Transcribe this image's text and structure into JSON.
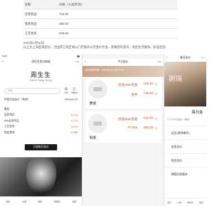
{
  "table": {
    "header": {
      "name": "名称",
      "price": "价格（人民币/克）"
    },
    "rows": [
      {
        "name": "足金饰品",
        "price": "723.00"
      },
      {
        "name": "铂金饰品",
        "price": "360.00"
      },
      {
        "name": "工艺金条",
        "price": "678.00"
      }
    ],
    "date": "2024年4月10日",
    "note": "以上为上海区域金价，全国其它地区请以门店报价公示金价为准，感谢您的支持，祝您生活愉快，好运连连!"
  },
  "panel1": {
    "status_time": "9:41",
    "nav_title": "周生生官方商城",
    "brand_logo": "周生生",
    "brand_sub": "Chow Sang Sang",
    "search_placeholder": "搜索",
    "icon_labels": [
      "分类",
      "购物车"
    ],
    "info_left": "中国大陆金价（每克）",
    "info_right": "2024-04-10",
    "section_label": "黄金:",
    "items": [
      {
        "label": "足金饰品",
        "value": "¥ 723"
      },
      {
        "label": "999足金饰品",
        "value": "¥ 723"
      },
      {
        "label": "工艺金条",
        "value": "¥ 678"
      },
      {
        "label": "铂金首饰",
        "value": "¥ 360"
      }
    ],
    "button_label": "订阅每日金价",
    "tabs": [
      "首页",
      "分类",
      "服务",
      "购物车",
      "我的"
    ]
  },
  "panel2": {
    "nav_title": "今日金价",
    "banner_text": "金价更新时间：2024年4月10日 09:21",
    "gold": {
      "name": "黄金",
      "lines": [
        {
          "label": "足金999/足金",
          "price": "728.00",
          "unit": "元"
        },
        {
          "label": "金条",
          "price": "718.00",
          "unit": "元"
        }
      ]
    },
    "platinum": {
      "name": "铂金",
      "lines": [
        {
          "label": "足铂999/足铂",
          "price": "416.00",
          "unit": "元"
        },
        {
          "label": "PT950",
          "price": "399.00",
          "unit": "元"
        }
      ]
    }
  },
  "panel3": {
    "nav_title": "每日金价",
    "photo_logo": "謝瑞",
    "sheet_title": "每日金",
    "sheet_note": "以下为今日金价（每克）",
    "options": [
      "足金(首饰操作)",
      "金条金价",
      "铂金金价",
      "增值回收服务"
    ],
    "tabs": [
      "首页",
      "分类",
      "购物车",
      "我的"
    ]
  }
}
